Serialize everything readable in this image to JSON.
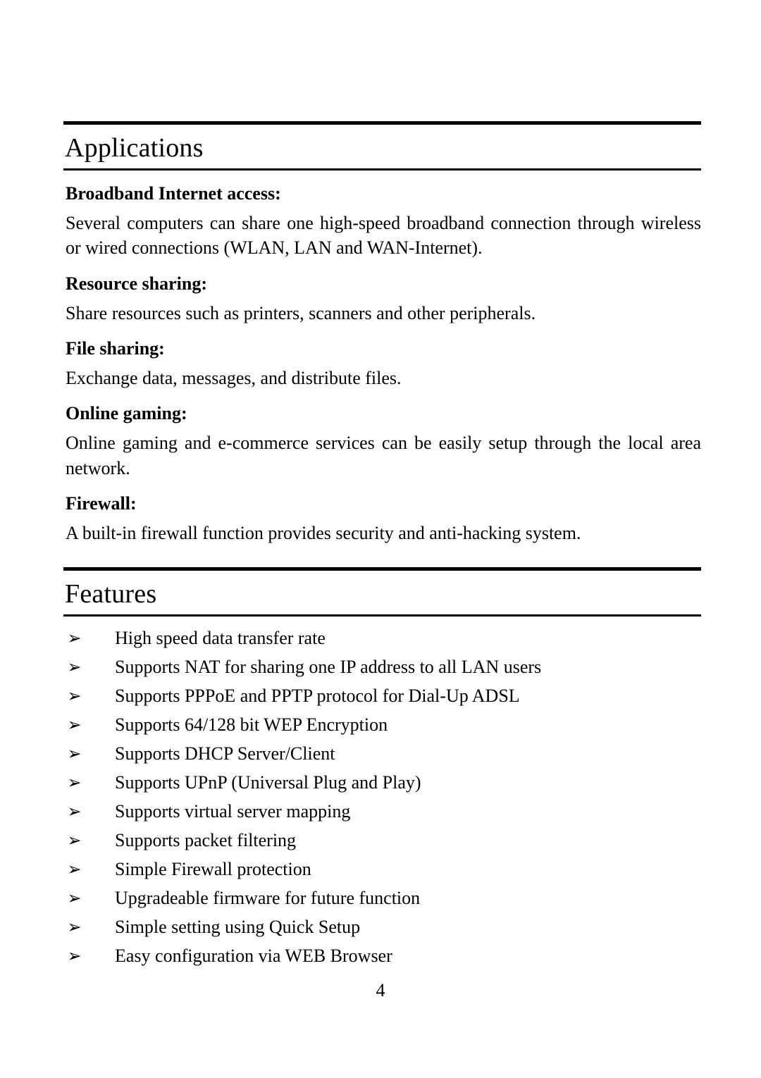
{
  "document": {
    "page_number": "4",
    "bullet_glyph": "➢"
  },
  "sections": [
    {
      "title": "Applications",
      "blocks": [
        {
          "heading": "Broadband Internet access:",
          "body": "Several computers can share one high-speed broadband connection through wireless or wired connections (WLAN, LAN and WAN-Internet)."
        },
        {
          "heading": "Resource sharing:",
          "body": "Share resources such as printers, scanners and other peripherals."
        },
        {
          "heading": "File sharing:",
          "body": "Exchange data, messages, and distribute files."
        },
        {
          "heading": "Online gaming:",
          "body": "Online gaming and e-commerce services can be easily setup through the local area network."
        },
        {
          "heading": "Firewall:",
          "body": "A built-in firewall function provides security and anti-hacking system."
        }
      ]
    },
    {
      "title": "Features",
      "bullets": [
        "High speed data transfer rate",
        "Supports NAT for sharing one IP address to all LAN users",
        "Supports PPPoE and PPTP protocol for Dial-Up ADSL",
        "Supports 64/128 bit WEP Encryption",
        "Supports DHCP Server/Client",
        "Supports UPnP (Universal Plug and Play)",
        "Supports virtual server mapping",
        "Supports packet filtering",
        "Simple Firewall protection",
        "Upgradeable firmware for future function",
        "Simple setting using Quick Setup",
        "Easy configuration via WEB Browser"
      ]
    }
  ]
}
